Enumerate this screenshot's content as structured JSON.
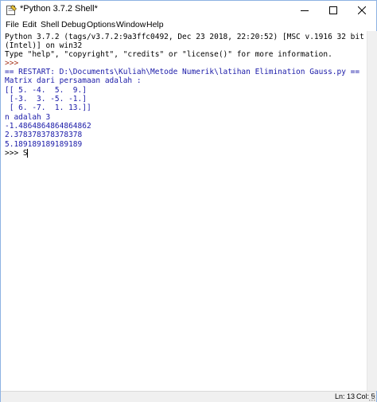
{
  "window": {
    "title": "*Python 3.7.2 Shell*",
    "minimize_icon": "minimize-icon",
    "maximize_icon": "maximize-icon",
    "close_icon": "close-icon"
  },
  "menubar": {
    "items": [
      "File",
      "Edit",
      "Shell",
      "Debug",
      "Options",
      "Window",
      "Help"
    ]
  },
  "shell": {
    "lines": [
      "Python 3.7.2 (tags/v3.7.2:9a3ffc0492, Dec 23 2018, 22:20:52) [MSC v.1916 32 bit",
      "(Intel)] on win32",
      "Type \"help\", \"copyright\", \"credits\" or \"license()\" for more information.",
      ">>> ",
      "== RESTART: D:\\Documents\\Kuliah\\Metode Numerik\\latihan Elimination Gauss.py ==",
      "Matrix dari persamaan adalah :",
      "[[ 5. -4.  5.  9.]",
      " [-3.  3. -5. -1.]",
      " [ 6. -7.  1. 13.]]",
      "n adalah 3",
      "-1.4864864864864862",
      "2.378378378378378",
      "5.189189189189189",
      ">>> S"
    ]
  },
  "statusbar": {
    "line": "Ln: 13",
    "col": "Col: 5"
  },
  "colors": {
    "output": "#1a1aa8",
    "prompt": "#a6331a",
    "text": "#000000",
    "window_border": "#8db2e3"
  }
}
